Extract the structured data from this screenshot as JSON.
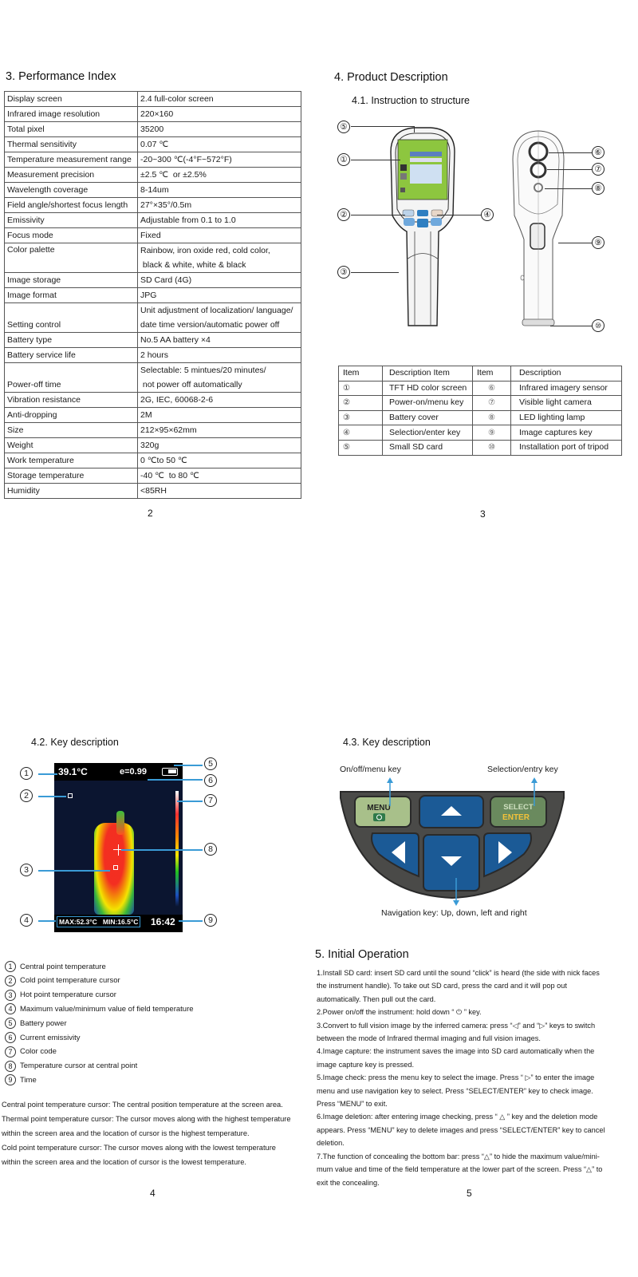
{
  "page2": {
    "heading": "3. Performance Index",
    "page_number": "2",
    "spec_rows": [
      {
        "key": "Display screen",
        "value": [
          "2.4 full-color screen"
        ]
      },
      {
        "key": "Infrared image resolution",
        "value": [
          "220×160"
        ]
      },
      {
        "key": "Total pixel",
        "value": [
          "35200"
        ]
      },
      {
        "key": "Thermal sensitivity",
        "value": [
          "0.07 ℃"
        ]
      },
      {
        "key": "Temperature measurement range",
        "value": [
          "-20~300 ℃(-4°F~572°F)"
        ]
      },
      {
        "key": "Measurement precision",
        "value": [
          "±2.5 ℃  or ±2.5%"
        ]
      },
      {
        "key": "Wavelength coverage",
        "value": [
          "8-14um"
        ]
      },
      {
        "key": "Field angle/shortest focus length",
        "value": [
          "27°×35°/0.5m"
        ]
      },
      {
        "key": "Emissivity",
        "value": [
          "Adjustable from 0.1 to 1.0"
        ]
      },
      {
        "key": "Focus mode",
        "value": [
          "Fixed"
        ]
      },
      {
        "key": "Color palette",
        "value": [
          "Rainbow, iron oxide red, cold color,",
          " black & white, white & black"
        ],
        "key_top": true
      },
      {
        "key": "Image storage",
        "value": [
          "SD Card (4G)"
        ]
      },
      {
        "key": "Image format",
        "value": [
          "JPG"
        ]
      },
      {
        "key": "Setting control",
        "value": [
          "Unit adjustment of localization/ language/",
          "date time version/automatic power off"
        ]
      },
      {
        "key": "Battery type",
        "value": [
          "No.5 AA battery ×4"
        ]
      },
      {
        "key": "Battery service life",
        "value": [
          "2 hours"
        ]
      },
      {
        "key": "Power-off time",
        "value": [
          "Selectable: 5 mintues/20 minutes/",
          " not power off automatically"
        ]
      },
      {
        "key": "Vibration resistance",
        "value": [
          "2G, IEC, 60068-2-6"
        ]
      },
      {
        "key": "Anti-dropping",
        "value": [
          "2M"
        ]
      },
      {
        "key": "Size",
        "value": [
          "212×95×62mm"
        ]
      },
      {
        "key": "Weight",
        "value": [
          "320g"
        ]
      },
      {
        "key": "Work temperature",
        "value": [
          "0 ℃to 50 ℃"
        ]
      },
      {
        "key": "Storage temperature",
        "value": [
          "-40 ℃  to 80 ℃"
        ]
      },
      {
        "key": "Humidity",
        "value": [
          "<85RH"
        ]
      }
    ]
  },
  "page3": {
    "heading": "4. Product Description",
    "subheading": "4.1. Instruction to structure",
    "page_number": "3",
    "callouts_front": [
      "⑤",
      "①",
      "②",
      "④",
      "③"
    ],
    "callouts_back": [
      "⑥",
      "⑦",
      "⑧",
      "⑨",
      "⑩"
    ],
    "parts_table": {
      "headers": [
        "Item",
        "Description Item",
        "Item",
        "Description"
      ],
      "rows": [
        [
          "①",
          "TFT HD color screen",
          "⑥",
          "Infrared imagery sensor"
        ],
        [
          "②",
          "Power-on/menu key",
          "⑦",
          "Visible light camera"
        ],
        [
          "③",
          "Battery cover",
          "⑧",
          "LED lighting lamp"
        ],
        [
          "④",
          "Selection/enter key",
          "⑨",
          "Image captures key"
        ],
        [
          "⑤",
          "Small SD card",
          "⑩",
          "Installation port of tripod"
        ]
      ]
    }
  },
  "page4": {
    "subheading": "4.2. Key description",
    "page_number": "4",
    "screen": {
      "center_temp": "39.1°C",
      "emissivity": "e=0.99",
      "max_min": "MAX:52.3°C   MIN:16.5°C",
      "time": "16:42"
    },
    "legend": [
      {
        "num": "1",
        "label": "Central point temperature"
      },
      {
        "num": "2",
        "label": "Cold point temperature cursor"
      },
      {
        "num": "3",
        "label": "Hot point temperature cursor"
      },
      {
        "num": "4",
        "label": "Maximum value/minimum value of field temperature"
      },
      {
        "num": "5",
        "label": "Battery power"
      },
      {
        "num": "6",
        "label": "Current emissivity"
      },
      {
        "num": "7",
        "label": "Color code"
      },
      {
        "num": "8",
        "label": "Temperature cursor at central point"
      },
      {
        "num": "9",
        "label": "Time"
      }
    ],
    "notes": [
      "Central point temperature cursor: The central position temperature at the screen area.",
      "Thermal point temperature cursor: The cursor moves along with the highest temperature",
      "within the screen area and the location of cursor is the highest temperature.",
      "Cold point temperature cursor: The cursor moves along with the lowest temperature",
      "within the screen area and the location of cursor is the lowest temperature."
    ]
  },
  "page5": {
    "subheading": "4.3. Key description",
    "page_number": "5",
    "keypad": {
      "menu_label": "On/off/menu key",
      "select_label": "Selection/entry key",
      "nav_label": "Navigation key: Up, down, left and right",
      "menu_key_text": "MENU",
      "select_key_text": "SELECT",
      "enter_key_text": "ENTER"
    },
    "op_heading": "5. Initial Operation",
    "op_lines": [
      "1.Install SD card: insert SD card until the sound “click” is heard (the side with nick faces",
      "the instrument handle). To take out SD card, press the card and it will pop out",
      "automatically. Then pull out the card.",
      "2.Power on/off the instrument: hold down “ ⏻ ” key.",
      "3.Convert to full vision image by the inferred camera: press “◁” and “▷” keys to switch",
      "between the mode of Infrared thermal imaging and full vision images.",
      "4.Image capture: the instrument saves the image into SD card automatically when the",
      "image capture key is pressed.",
      "5.Image check: press the menu key to select the image. Press “ ▷” to enter the image",
      "menu and use navigation key to select. Press “SELECT/ENTER” key to check image.",
      "Press “MENU” to exit.",
      "6.Image deletion: after entering image checking, press “ △ ” key and the deletion mode",
      "appears. Press “MENU” key to delete images and press “SELECT/ENTER” key to cancel",
      "deletion.",
      "7.The function of concealing the bottom bar: press “△” to hide the maximum value/mini-",
      "mum value and time of the field temperature at the lower part of the screen. Press “△” to",
      "exit the concealing."
    ]
  }
}
